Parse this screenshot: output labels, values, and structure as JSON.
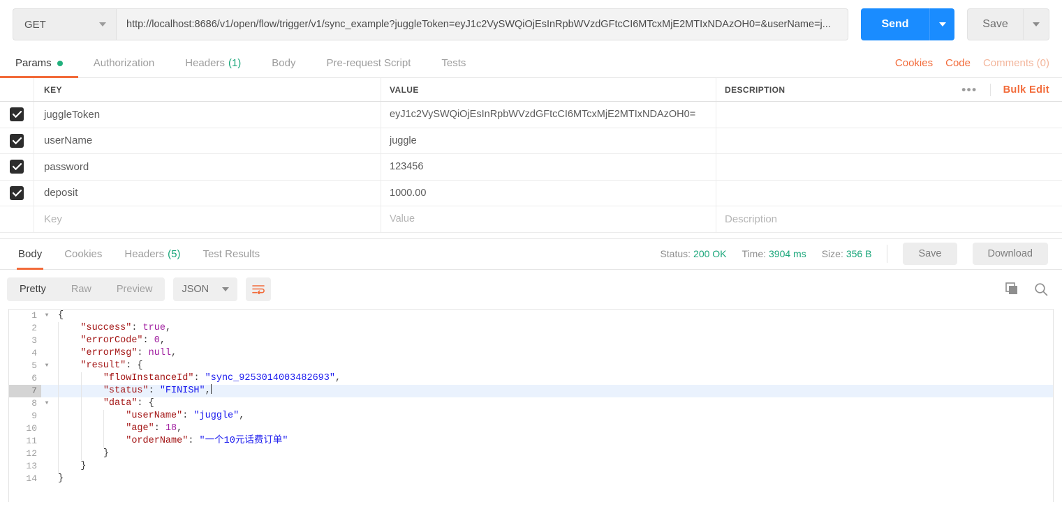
{
  "request": {
    "method": "GET",
    "url": "http://localhost:8686/v1/open/flow/trigger/v1/sync_example?juggleToken=eyJ1c2VySWQiOjEsInRpbWVzdGFtcCI6MTcxMjE2MTIxNDAzOH0=&userName=j...",
    "send_label": "Send",
    "save_label": "Save"
  },
  "request_tabs": {
    "items": [
      {
        "label": "Params",
        "active": true,
        "dot": true
      },
      {
        "label": "Authorization",
        "active": false
      },
      {
        "label": "Headers",
        "count": "(1)",
        "active": false
      },
      {
        "label": "Body",
        "active": false
      },
      {
        "label": "Pre-request Script",
        "active": false
      },
      {
        "label": "Tests",
        "active": false
      }
    ],
    "right": {
      "cookies": "Cookies",
      "code": "Code",
      "comments": "Comments (0)"
    }
  },
  "params": {
    "headers": {
      "key": "KEY",
      "value": "VALUE",
      "description": "DESCRIPTION"
    },
    "bulk_edit": "Bulk Edit",
    "rows": [
      {
        "checked": true,
        "key": "juggleToken",
        "value": "eyJ1c2VySWQiOjEsInRpbWVzdGFtcCI6MTcxMjE2MTIxNDAzOH0=",
        "description": ""
      },
      {
        "checked": true,
        "key": "userName",
        "value": "juggle",
        "description": ""
      },
      {
        "checked": true,
        "key": "password",
        "value": "123456",
        "description": ""
      },
      {
        "checked": true,
        "key": "deposit",
        "value": "1000.00",
        "description": ""
      }
    ],
    "new_row": {
      "key_placeholder": "Key",
      "value_placeholder": "Value",
      "description_placeholder": "Description"
    }
  },
  "response_tabs": {
    "items": [
      {
        "label": "Body",
        "active": true
      },
      {
        "label": "Cookies",
        "active": false
      },
      {
        "label": "Headers",
        "count": "(5)",
        "active": false
      },
      {
        "label": "Test Results",
        "active": false
      }
    ],
    "meta": {
      "status_label": "Status:",
      "status_value": "200 OK",
      "time_label": "Time:",
      "time_value": "3904 ms",
      "size_label": "Size:",
      "size_value": "356 B"
    },
    "save_label": "Save",
    "download_label": "Download"
  },
  "body_toolbar": {
    "modes": [
      {
        "label": "Pretty",
        "active": true
      },
      {
        "label": "Raw",
        "active": false
      },
      {
        "label": "Preview",
        "active": false
      }
    ],
    "format": "JSON",
    "wrap_icon": "word-wrap-icon",
    "copy_icon": "copy-icon",
    "search_icon": "search-icon"
  },
  "response_body": {
    "active_line": 7,
    "lines": [
      {
        "n": 1,
        "fold": true,
        "indent": 0,
        "tokens": [
          {
            "t": "{",
            "c": "pun"
          }
        ]
      },
      {
        "n": 2,
        "fold": false,
        "indent": 1,
        "tokens": [
          {
            "t": "\"success\"",
            "c": "k"
          },
          {
            "t": ": ",
            "c": "pun"
          },
          {
            "t": "true",
            "c": "bool"
          },
          {
            "t": ",",
            "c": "pun"
          }
        ]
      },
      {
        "n": 3,
        "fold": false,
        "indent": 1,
        "tokens": [
          {
            "t": "\"errorCode\"",
            "c": "k"
          },
          {
            "t": ": ",
            "c": "pun"
          },
          {
            "t": "0",
            "c": "num"
          },
          {
            "t": ",",
            "c": "pun"
          }
        ]
      },
      {
        "n": 4,
        "fold": false,
        "indent": 1,
        "tokens": [
          {
            "t": "\"errorMsg\"",
            "c": "k"
          },
          {
            "t": ": ",
            "c": "pun"
          },
          {
            "t": "null",
            "c": "bool"
          },
          {
            "t": ",",
            "c": "pun"
          }
        ]
      },
      {
        "n": 5,
        "fold": true,
        "indent": 1,
        "tokens": [
          {
            "t": "\"result\"",
            "c": "k"
          },
          {
            "t": ": {",
            "c": "pun"
          }
        ]
      },
      {
        "n": 6,
        "fold": false,
        "indent": 2,
        "tokens": [
          {
            "t": "\"flowInstanceId\"",
            "c": "k"
          },
          {
            "t": ": ",
            "c": "pun"
          },
          {
            "t": "\"sync_9253014003482693\"",
            "c": "s"
          },
          {
            "t": ",",
            "c": "pun"
          }
        ]
      },
      {
        "n": 7,
        "fold": false,
        "indent": 2,
        "tokens": [
          {
            "t": "\"status\"",
            "c": "k"
          },
          {
            "t": ": ",
            "c": "pun"
          },
          {
            "t": "\"FINISH\"",
            "c": "s"
          },
          {
            "t": ",",
            "c": "pun"
          }
        ]
      },
      {
        "n": 8,
        "fold": true,
        "indent": 2,
        "tokens": [
          {
            "t": "\"data\"",
            "c": "k"
          },
          {
            "t": ": {",
            "c": "pun"
          }
        ]
      },
      {
        "n": 9,
        "fold": false,
        "indent": 3,
        "tokens": [
          {
            "t": "\"userName\"",
            "c": "k"
          },
          {
            "t": ": ",
            "c": "pun"
          },
          {
            "t": "\"juggle\"",
            "c": "s"
          },
          {
            "t": ",",
            "c": "pun"
          }
        ]
      },
      {
        "n": 10,
        "fold": false,
        "indent": 3,
        "tokens": [
          {
            "t": "\"age\"",
            "c": "k"
          },
          {
            "t": ": ",
            "c": "pun"
          },
          {
            "t": "18",
            "c": "num"
          },
          {
            "t": ",",
            "c": "pun"
          }
        ]
      },
      {
        "n": 11,
        "fold": false,
        "indent": 3,
        "tokens": [
          {
            "t": "\"orderName\"",
            "c": "k"
          },
          {
            "t": ": ",
            "c": "pun"
          },
          {
            "t": "\"一个10元话费订单\"",
            "c": "s"
          }
        ]
      },
      {
        "n": 12,
        "fold": false,
        "indent": 2,
        "tokens": [
          {
            "t": "}",
            "c": "pun"
          }
        ]
      },
      {
        "n": 13,
        "fold": false,
        "indent": 1,
        "tokens": [
          {
            "t": "}",
            "c": "pun"
          }
        ]
      },
      {
        "n": 14,
        "fold": false,
        "indent": 0,
        "tokens": [
          {
            "t": "}",
            "c": "pun"
          }
        ]
      }
    ]
  },
  "colors": {
    "accent_orange": "#f26b3a",
    "send_blue": "#1a8cff",
    "status_green": "#1aa67a",
    "string_blue": "#1a1aee",
    "key_red": "#a31515",
    "literal_purple": "#a020a0"
  }
}
